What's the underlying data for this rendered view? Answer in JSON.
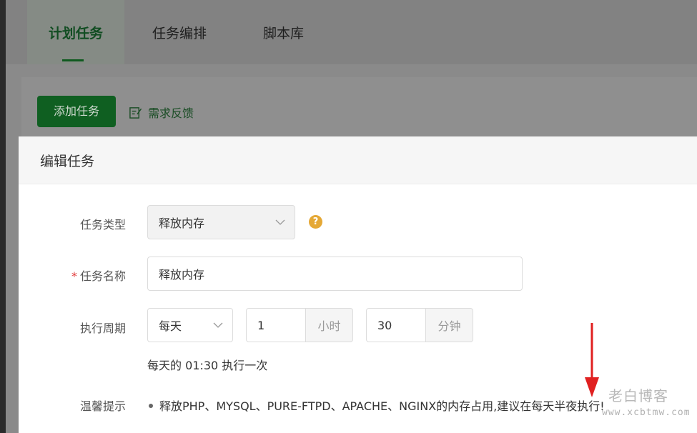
{
  "tabs": [
    {
      "label": "计划任务",
      "active": true
    },
    {
      "label": "任务编排",
      "active": false
    },
    {
      "label": "脚本库",
      "active": false
    }
  ],
  "toolbar": {
    "add_label": "添加任务",
    "feedback_label": "需求反馈"
  },
  "dialog": {
    "title": "编辑任务",
    "task_type": {
      "label": "任务类型",
      "value": "释放内存"
    },
    "task_name": {
      "label": "任务名称",
      "value": "释放内存",
      "required_mark": "*"
    },
    "period": {
      "label": "执行周期",
      "frequency": "每天",
      "hours": "1",
      "hours_unit": "小时",
      "minutes": "30",
      "minutes_unit": "分钟",
      "summary": "每天的 01:30 执行一次"
    },
    "tip": {
      "label": "温馨提示",
      "text": "释放PHP、MYSQL、PURE-FTPD、APACHE、NGINX的内存占用,建议在每天半夜执行!"
    },
    "help_mark": "?"
  },
  "watermark": {
    "name": "老白博客",
    "url": "www.xcbtmw.com"
  },
  "colors": {
    "accent": "#20a53a",
    "required": "#e23b3b",
    "help": "#e5a835",
    "arrow": "#e02020"
  }
}
